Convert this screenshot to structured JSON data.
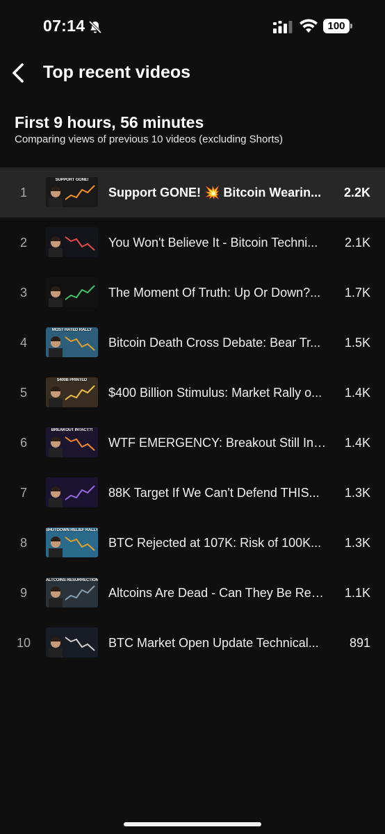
{
  "status_bar": {
    "time": "07:14",
    "battery": "100"
  },
  "header": {
    "title": "Top recent videos"
  },
  "section": {
    "title": "First 9 hours, 56 minutes",
    "subtitle": "Comparing views of previous 10 videos (excluding Shorts)"
  },
  "videos": [
    {
      "rank": "1",
      "title": "Support GONE! 💥 Bitcoin Wearin...",
      "views": "2.2K",
      "thumb_text": "SUPPORT GONE!",
      "thumb_bg": "#1a1a1a",
      "thumb_accent": "#f7931a",
      "highlight": true
    },
    {
      "rank": "2",
      "title": "You Won't Believe It - Bitcoin Techni...",
      "views": "2.1K",
      "thumb_text": "",
      "thumb_bg": "#14151a",
      "thumb_accent": "#e24a4a",
      "highlight": false
    },
    {
      "rank": "3",
      "title": "The Moment Of Truth: Up Or Down?...",
      "views": "1.7K",
      "thumb_text": "",
      "thumb_bg": "#121212",
      "thumb_accent": "#3ec46d",
      "highlight": false
    },
    {
      "rank": "4",
      "title": "Bitcoin Death Cross Debate: Bear Tr...",
      "views": "1.5K",
      "thumb_text": "MOST HATED RALLY",
      "thumb_bg": "#2d5f7a",
      "thumb_accent": "#e0a030",
      "highlight": false
    },
    {
      "rank": "5",
      "title": "$400 Billion Stimulus: Market Rally o...",
      "views": "1.4K",
      "thumb_text": "$400B PRINTED",
      "thumb_bg": "#3a2e22",
      "thumb_accent": "#f0c040",
      "highlight": false
    },
    {
      "rank": "6",
      "title": "WTF EMERGENCY: Breakout Still Int...",
      "views": "1.4K",
      "thumb_text": "BREAKOUT INTACT?!",
      "thumb_bg": "#1c1530",
      "thumb_accent": "#f08a2a",
      "highlight": false
    },
    {
      "rank": "7",
      "title": "88K Target If We Can't Defend THIS...",
      "views": "1.3K",
      "thumb_text": "",
      "thumb_bg": "#1a1430",
      "thumb_accent": "#9a6ae0",
      "highlight": false
    },
    {
      "rank": "8",
      "title": "BTC Rejected at 107K: Risk of 100K...",
      "views": "1.3K",
      "thumb_text": "SHUTDOWN RELIEF RALLY",
      "thumb_bg": "#2a6a8a",
      "thumb_accent": "#e0a030",
      "highlight": false
    },
    {
      "rank": "9",
      "title": "Altcoins Are Dead - Can They Be Rev...",
      "views": "1.1K",
      "thumb_text": "ALTCOINS RESURRECTION NEEDED",
      "thumb_bg": "#2a323a",
      "thumb_accent": "#8aa0b0",
      "highlight": false
    },
    {
      "rank": "10",
      "title": "BTC Market Open Update Technical...",
      "views": "891",
      "thumb_text": "",
      "thumb_bg": "#181c24",
      "thumb_accent": "#d0d0d0",
      "highlight": false
    }
  ]
}
